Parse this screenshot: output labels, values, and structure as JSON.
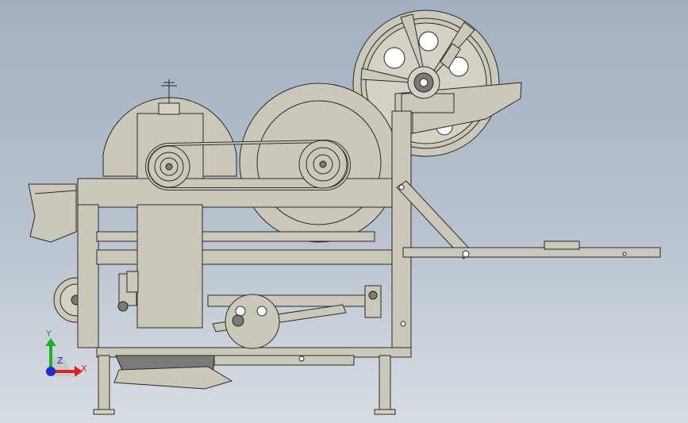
{
  "triad": {
    "y_label": "Y",
    "x_label": "X",
    "z_label": "Z",
    "colors": {
      "x": "#e02020",
      "y": "#1fae2a",
      "z": "#1c2ad8"
    }
  },
  "colors": {
    "background_top": "#a3afc0",
    "background_bottom": "#d8dde3",
    "part_fill": "#c9c8b9",
    "edge": "#2a2a2a"
  }
}
